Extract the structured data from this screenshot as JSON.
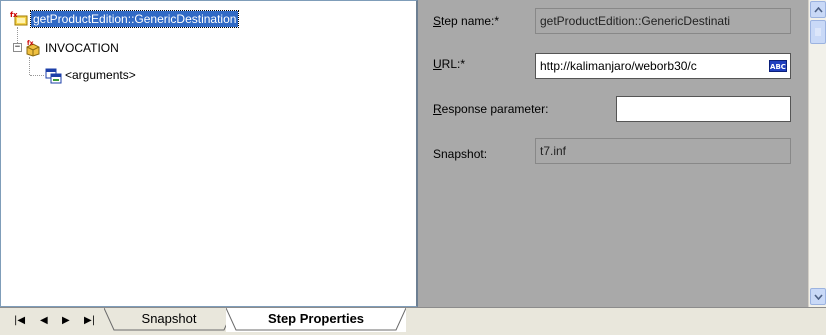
{
  "tree": {
    "root": {
      "label": "getProductEdition::GenericDestination",
      "icon": "step-icon",
      "selected": true
    },
    "children": [
      {
        "label": "INVOCATION",
        "icon": "invocation-icon",
        "expander": "−",
        "children": [
          {
            "label": "<arguments>",
            "icon": "arguments-icon"
          }
        ]
      }
    ]
  },
  "properties": {
    "step_name": {
      "label_underlined": "S",
      "label_rest": "tep name:*",
      "value": "getProductEdition::GenericDestinati"
    },
    "url": {
      "label_underlined": "U",
      "label_rest": "RL:*",
      "value": "http://kalimanjaro/weborb30/c",
      "badge": "ABC"
    },
    "response_parameter": {
      "label_underlined": "R",
      "label_rest": "esponse parameter:",
      "value": ""
    },
    "snapshot": {
      "label": "Snapshot:",
      "value": "t7.inf"
    }
  },
  "tabs": {
    "nav": [
      "|◀",
      "◀",
      "▶",
      "▶|"
    ],
    "items": [
      {
        "label": "Snapshot",
        "active": false
      },
      {
        "label": "Step Properties",
        "active": true
      }
    ]
  },
  "colors": {
    "selection": "#316ac5",
    "props_background": "#a9a9a9",
    "tab_bar": "#e9e7dc"
  }
}
